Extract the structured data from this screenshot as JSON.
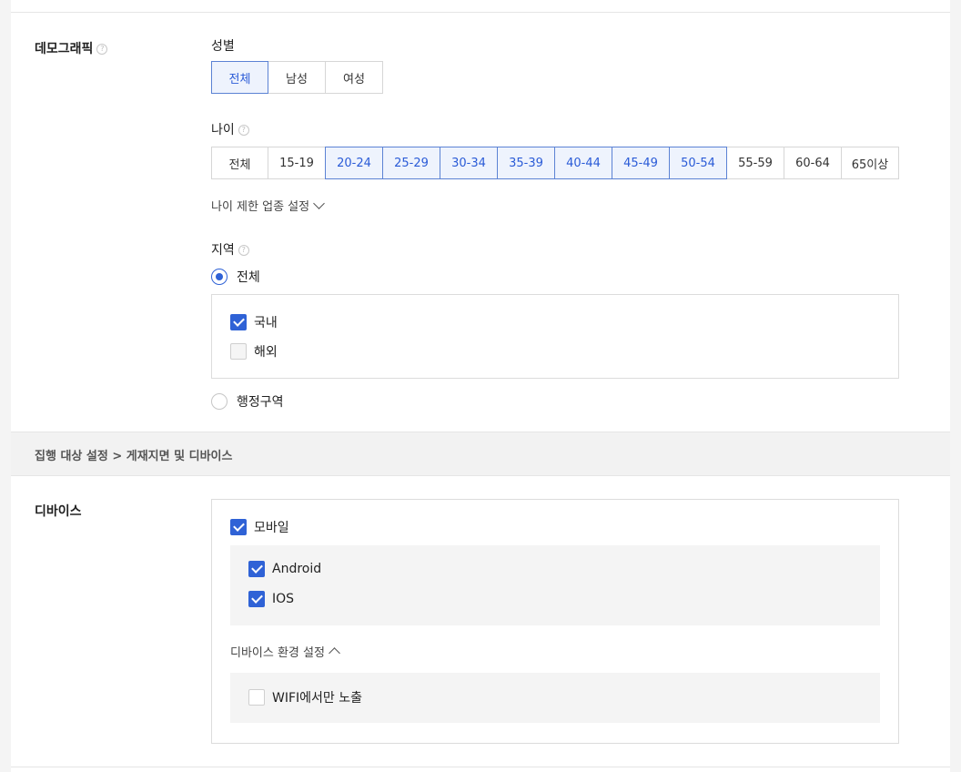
{
  "demographic": {
    "title": "데모그래픽",
    "help_icon": "question-circle-icon",
    "gender": {
      "label": "성별",
      "options": [
        "전체",
        "남성",
        "여성"
      ],
      "selected": [
        "전체"
      ]
    },
    "age": {
      "label": "나이",
      "options": [
        "전체",
        "15-19",
        "20-24",
        "25-29",
        "30-34",
        "35-39",
        "40-44",
        "45-49",
        "50-54",
        "55-59",
        "60-64",
        "65이상"
      ],
      "selected": [
        "20-24",
        "25-29",
        "30-34",
        "35-39",
        "40-44",
        "45-49",
        "50-54"
      ],
      "restriction_toggle": "나이 제한 업종 설정"
    },
    "region": {
      "label": "지역",
      "radio_all": "전체",
      "radio_admin": "행정구역",
      "selected_radio": "전체",
      "domestic": {
        "label": "국내",
        "checked": true
      },
      "overseas": {
        "label": "해외",
        "checked": false
      }
    }
  },
  "band": {
    "breadcrumb": "집행 대상 설정 > 게재지면 및 디바이스"
  },
  "device": {
    "title": "디바이스",
    "mobile": {
      "label": "모바일",
      "checked": true
    },
    "android": {
      "label": "Android",
      "checked": true
    },
    "ios": {
      "label": "IOS",
      "checked": true
    },
    "env_toggle": "디바이스 환경 설정",
    "wifi_only": {
      "label": "WIFI에서만 노출",
      "checked": false
    }
  },
  "colors": {
    "accent": "#2f62d6",
    "selected_bg": "#eef3fd"
  }
}
